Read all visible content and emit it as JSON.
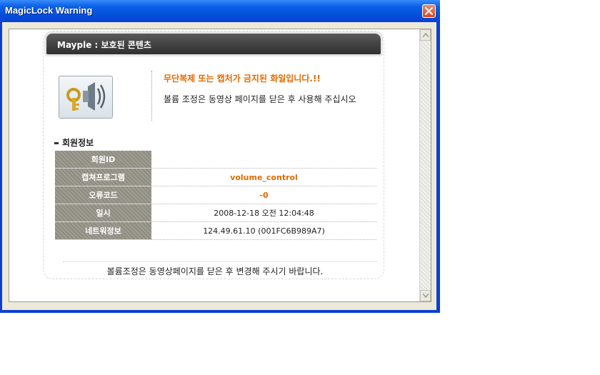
{
  "window": {
    "title": "MagicLock Warning"
  },
  "banner": {
    "text": "Mayple : 보호된 콘텐츠"
  },
  "warning": {
    "title": "무단복제 또는 캡처가 금지된 화일입니다.!!",
    "description": "볼륨 조정은 동영상 페이지를 닫은 후 사용해 주십시오"
  },
  "member_info": {
    "section_title": "회원정보",
    "rows": [
      {
        "label": "회원ID",
        "value": ""
      },
      {
        "label": "캡쳐프로그램",
        "value": "volume_control"
      },
      {
        "label": "오류코드",
        "value": "-0"
      },
      {
        "label": "일시",
        "value": "2008-12-18 오전 12:04:48"
      },
      {
        "label": "네트워정보",
        "value": "124.49.61.10 (001FC6B989A7)"
      }
    ]
  },
  "footer": {
    "text": "볼륨조정은 동영상페이지를 닫은 후 변경해 주시기 바랍니다."
  },
  "colors": {
    "title_bar": "#0a5fe8",
    "accent_orange": "#e26a00",
    "close_button": "#d14b22"
  },
  "icons": {
    "app_icon": "speaker-key-icon",
    "close": "close-icon"
  }
}
